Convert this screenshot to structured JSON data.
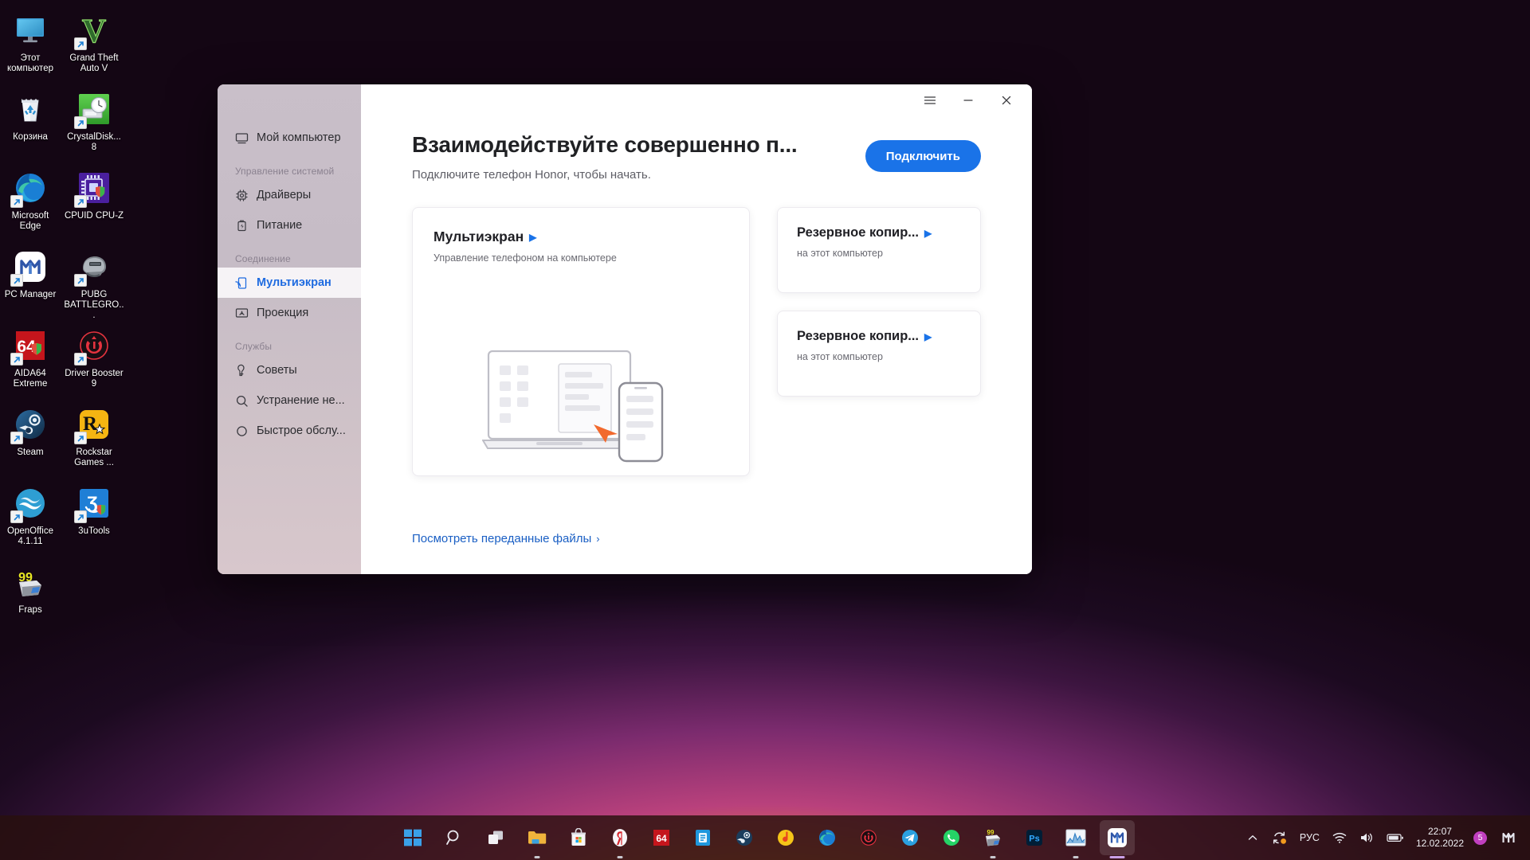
{
  "desktop": {
    "icons": [
      {
        "label": "Этот компьютер",
        "icon": "this-pc-icon",
        "shortcut": false
      },
      {
        "label": "Grand Theft Auto V",
        "icon": "gta-v-icon",
        "shortcut": true
      },
      {
        "label": "Корзина",
        "icon": "recycle-bin-icon",
        "shortcut": false
      },
      {
        "label": "CrystalDisk... 8",
        "icon": "crystaldiskmark-icon",
        "shortcut": true
      },
      {
        "label": "Microsoft Edge",
        "icon": "microsoft-edge-icon",
        "shortcut": true
      },
      {
        "label": "CPUID CPU-Z",
        "icon": "cpu-z-icon",
        "shortcut": true
      },
      {
        "label": "PC Manager",
        "icon": "pc-manager-icon",
        "shortcut": true
      },
      {
        "label": "PUBG BATTLEGRO...",
        "icon": "pubg-icon",
        "shortcut": true
      },
      {
        "label": "AIDA64 Extreme",
        "icon": "aida64-icon",
        "shortcut": true
      },
      {
        "label": "Driver Booster 9",
        "icon": "driver-booster-icon",
        "shortcut": true
      },
      {
        "label": "Steam",
        "icon": "steam-icon",
        "shortcut": true
      },
      {
        "label": "Rockstar Games ...",
        "icon": "rockstar-games-icon",
        "shortcut": true
      },
      {
        "label": "OpenOffice 4.1.11",
        "icon": "openoffice-icon",
        "shortcut": true
      },
      {
        "label": "3uTools",
        "icon": "3utools-icon",
        "shortcut": true
      },
      {
        "label": "Fraps",
        "icon": "fraps-icon",
        "shortcut": false
      }
    ]
  },
  "window": {
    "titlebar": {
      "menu_label": "☰",
      "minimize_label": "—",
      "close_label": "✕"
    },
    "sidebar": {
      "top_item": {
        "label": "Мой компьютер",
        "icon": "monitor-icon"
      },
      "sections": [
        {
          "title": "Управление системой",
          "items": [
            {
              "label": "Драйверы",
              "icon": "chip-icon",
              "active": false
            },
            {
              "label": "Питание",
              "icon": "battery-icon",
              "active": false
            }
          ]
        },
        {
          "title": "Соединение",
          "items": [
            {
              "label": "Мультиэкран",
              "icon": "multiscreen-icon",
              "active": true
            },
            {
              "label": "Проекция",
              "icon": "projection-icon",
              "active": false
            }
          ]
        },
        {
          "title": "Службы",
          "items": [
            {
              "label": "Советы",
              "icon": "tips-icon",
              "active": false
            },
            {
              "label": "Устранение не...",
              "icon": "search-icon",
              "active": false
            },
            {
              "label": "Быстрое обслу...",
              "icon": "shield-icon",
              "active": false
            }
          ]
        }
      ]
    },
    "hero": {
      "title": "Взаимодействуйте совершенно п...",
      "subtitle": "Подключите телефон Honor, чтобы начать.",
      "connect_button": "Подключить"
    },
    "cards": {
      "main": {
        "title": "Мультиэкран",
        "arrow": "▶",
        "subtitle": "Управление телефоном на компьютере",
        "illustration": "laptop-phone-illustration"
      },
      "right": [
        {
          "title": "Резервное копир...",
          "arrow": "▶",
          "subtitle": "на этот компьютер"
        },
        {
          "title": "Резервное копир...",
          "arrow": "▶",
          "subtitle": "на этот компьютер"
        }
      ]
    },
    "footer_link": {
      "label": "Посмотреть переданные файлы",
      "chevron": "›"
    },
    "accent_color": "#1a73e8"
  },
  "taskbar": {
    "items": [
      {
        "name": "start-button",
        "icon": "windows-logo-icon",
        "running": false
      },
      {
        "name": "search-button",
        "icon": "search-icon",
        "running": false
      },
      {
        "name": "task-view-button",
        "icon": "task-view-icon",
        "running": false
      },
      {
        "name": "file-explorer",
        "icon": "folder-icon",
        "running": true
      },
      {
        "name": "microsoft-store",
        "icon": "store-icon",
        "running": false
      },
      {
        "name": "yandex-browser",
        "icon": "yandex-icon",
        "running": true
      },
      {
        "name": "aida64",
        "icon": "aida64-icon",
        "running": false
      },
      {
        "name": "utility-app",
        "icon": "blue-tool-icon",
        "running": false
      },
      {
        "name": "steam",
        "icon": "steam-icon",
        "running": false
      },
      {
        "name": "music-app",
        "icon": "music-icon",
        "running": false
      },
      {
        "name": "microsoft-edge",
        "icon": "edge-icon",
        "running": false
      },
      {
        "name": "driver-booster",
        "icon": "driver-booster-icon",
        "running": false
      },
      {
        "name": "telegram",
        "icon": "telegram-icon",
        "running": false
      },
      {
        "name": "whatsapp",
        "icon": "whatsapp-icon",
        "running": false
      },
      {
        "name": "fraps",
        "icon": "fraps-icon",
        "running": true
      },
      {
        "name": "photoshop",
        "icon": "photoshop-icon",
        "running": false
      },
      {
        "name": "monitoring-app",
        "icon": "chart-icon",
        "running": true
      },
      {
        "name": "pc-manager",
        "icon": "pc-manager-icon",
        "running": true
      }
    ],
    "tray": {
      "overflow": "˄",
      "sync_icon": "sync-icon",
      "language": "РУС",
      "wifi_icon": "wifi-icon",
      "volume_icon": "volume-icon",
      "battery_icon": "battery-icon",
      "time": "22:07",
      "date": "12.02.2022",
      "notification_count": "5",
      "right_app_icon": "pc-manager-icon"
    }
  }
}
